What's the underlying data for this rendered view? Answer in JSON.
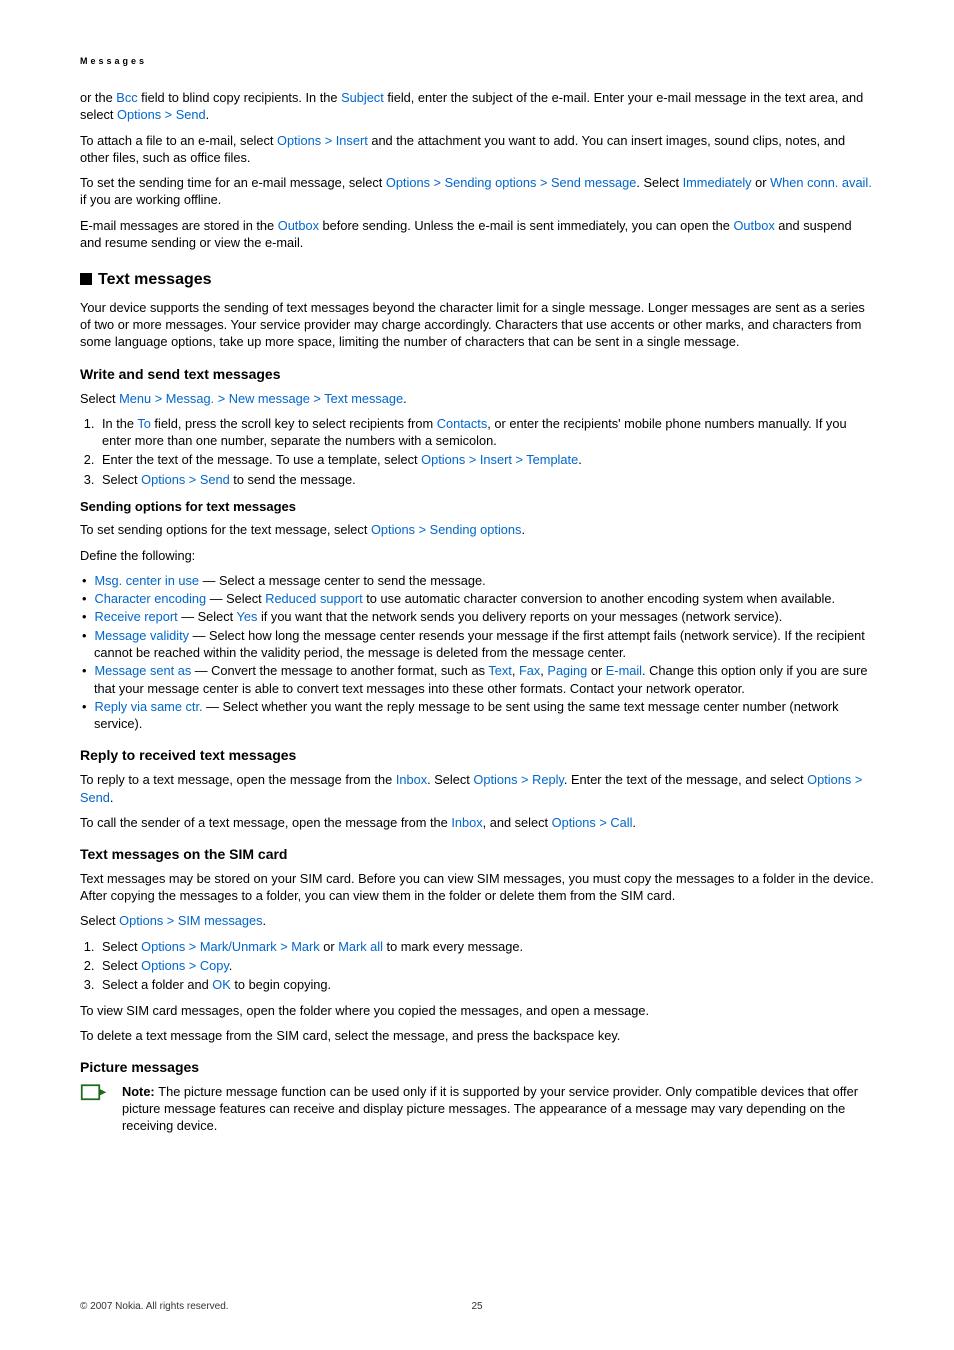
{
  "header": "Messages",
  "intro": {
    "p1a": "or the ",
    "bcc": "Bcc",
    "p1b": " field to blind copy recipients. In the ",
    "subject": "Subject",
    "p1c": " field, enter the subject of the e-mail. Enter your e-mail message in the text area, and select ",
    "options": "Options",
    "send": "Send",
    "period": ".",
    "p2a": "To attach a file to an e-mail, select ",
    "insert": "Insert",
    "p2b": " and the attachment you want to add. You can insert images, sound clips, notes, and other files, such as office files.",
    "p3a": "To set the sending time for an e-mail message, select ",
    "sending_options": "Sending options",
    "send_message": "Send message",
    "p3b": ". Select ",
    "immediately": "Immediately",
    "p3or": " or ",
    "when_conn": "When conn. avail.",
    "p3c": " if you are working offline.",
    "p4a": "E-mail messages are stored in the ",
    "outbox": "Outbox",
    "p4b": " before sending. Unless the e-mail is sent immediately, you can open the ",
    "p4c": " and suspend and resume sending or view the e-mail."
  },
  "text_messages": {
    "title": "Text messages",
    "para": "Your device supports the sending of text messages beyond the character limit for a single message. Longer messages are sent as a series of two or more messages. Your service provider may charge accordingly. Characters that use accents or other marks, and characters from some language options, take up more space, limiting the number of characters that can be sent in a single message."
  },
  "write_send": {
    "title": "Write and send text messages",
    "select": "Select ",
    "menu": "Menu",
    "messag": "Messag.",
    "new_message": "New message",
    "text_message": "Text message",
    "li1a": "In the ",
    "to": "To",
    "li1b": " field, press the scroll key to select recipients from ",
    "contacts": "Contacts",
    "li1c": ", or enter the recipients' mobile phone numbers manually. If you enter more than one number, separate the numbers with a semicolon.",
    "li2a": "Enter the text of the message. To use a template, select ",
    "options": "Options",
    "insert": "Insert",
    "template": "Template",
    "li3a": "Select ",
    "send": "Send",
    "li3b": " to send the message."
  },
  "sending_opts": {
    "title": "Sending options for text messages",
    "p1a": "To set sending options for the text message, select ",
    "options": "Options",
    "sending_options": "Sending options",
    "define": "Define the following:",
    "i1": "Msg. center in use",
    "i1t": " — Select a message center to send the message.",
    "i2": "Character encoding",
    "i2a": " — Select ",
    "i2r": "Reduced support",
    "i2t": " to use automatic character conversion to another encoding system when available.",
    "i3": "Receive report",
    "i3a": " — Select ",
    "i3y": "Yes",
    "i3t": " if you want that the network sends you delivery reports on your messages (network service).",
    "i4": "Message validity",
    "i4t": " — Select how long the message center resends your message if the first attempt fails (network service). If the recipient cannot be reached within the validity period, the message is deleted from the message center.",
    "i5": "Message sent as",
    "i5a": " — Convert the message to another format, such as ",
    "i5text": "Text",
    "i5fax": "Fax",
    "i5paging": "Paging",
    "i5or": " or ",
    "i5email": "E-mail",
    "i5t": ". Change this option only if you are sure that your message center is able to convert text messages into these other formats. Contact your network operator.",
    "i6": "Reply via same ctr.",
    "i6t": " — Select whether you want the reply message to be sent using the same text message center number (network service)."
  },
  "reply": {
    "title": "Reply to received text messages",
    "p1a": "To reply to a text message, open the message from the ",
    "inbox": "Inbox",
    "p1b": ". Select ",
    "options": "Options",
    "reply": "Reply",
    "p1c": ". Enter the text of the message, and select ",
    "send": "Send",
    "p2a": "To call the sender of a text message, open the message from the ",
    "p2b": ", and select ",
    "call": "Call"
  },
  "sim": {
    "title": "Text messages on the SIM card",
    "p1": "Text messages may be stored on your SIM card. Before you can view SIM messages, you must copy the messages to a folder in the device. After copying the messages to a folder, you can view them in the folder or delete them from the SIM card.",
    "select": "Select ",
    "options": "Options",
    "sim_messages": "SIM messages",
    "li1a": "Select ",
    "mark_unmark": "Mark/Unmark",
    "mark": "Mark",
    "li1or": " or ",
    "mark_all": "Mark all",
    "li1b": " to mark every message.",
    "li2a": "Select ",
    "copy": "Copy",
    "li3a": "Select a folder and ",
    "ok": "OK",
    "li3b": " to begin copying.",
    "p2": "To view SIM card messages, open the folder where you copied the messages, and open a message.",
    "p3": "To delete a text message from the SIM card, select the message, and press the backspace key."
  },
  "picture": {
    "title": "Picture messages",
    "note_label": "Note:  ",
    "note": "The picture message function can be used only if it is supported by your service provider. Only compatible devices that offer picture message features can receive and display picture messages. The appearance of a message may vary depending on the receiving device."
  },
  "footer": {
    "copyright": "© 2007 Nokia. All rights reserved.",
    "page": "25"
  }
}
